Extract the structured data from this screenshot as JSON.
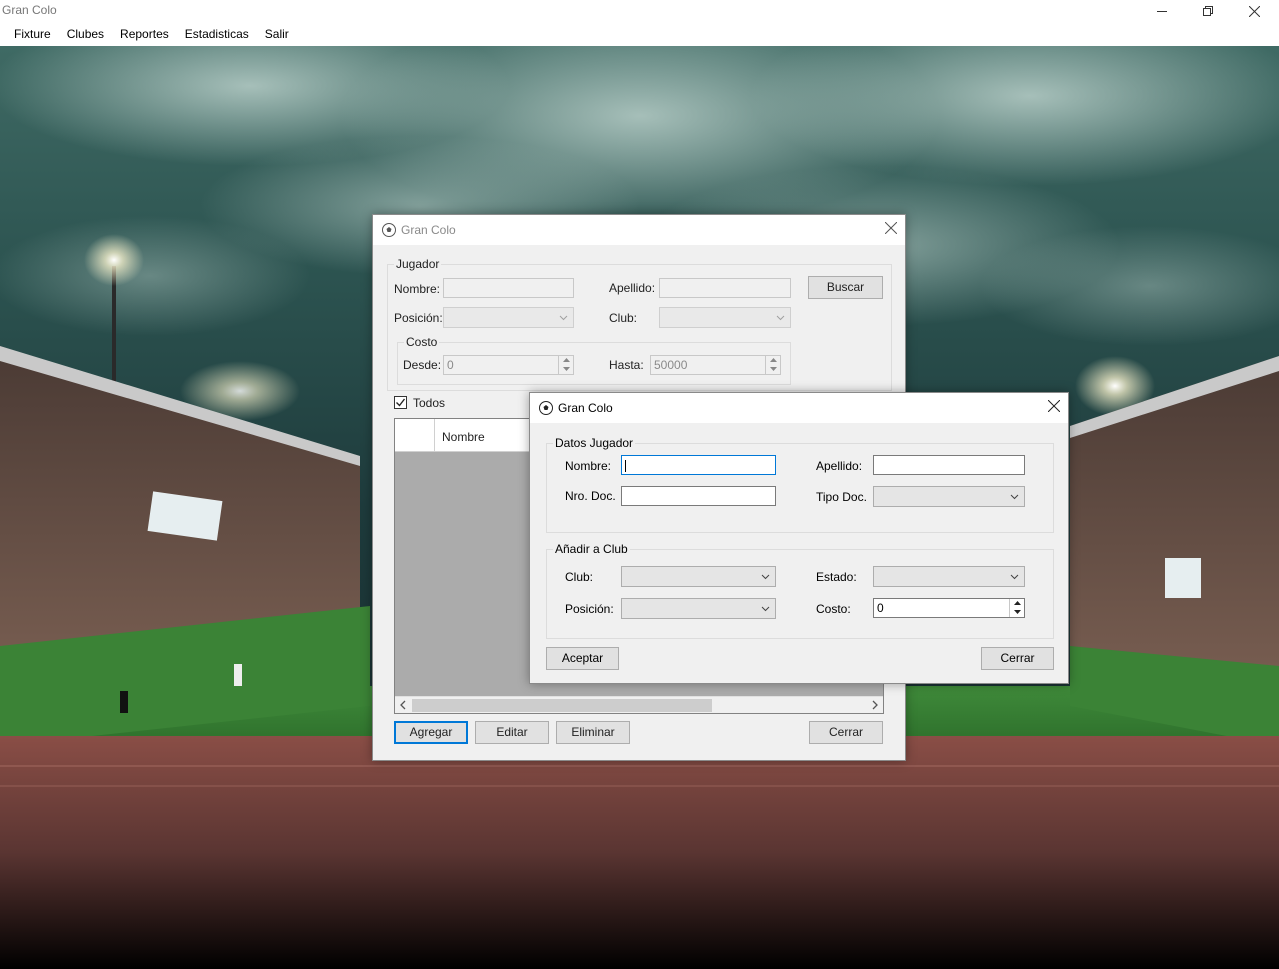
{
  "app": {
    "title": "Gran Colo"
  },
  "menu": [
    "Fixture",
    "Clubes",
    "Reportes",
    "Estadisticas",
    "Salir"
  ],
  "players_dialog": {
    "title": "Gran Colo",
    "group_label": "Jugador",
    "nombre_label": "Nombre:",
    "nombre_value": "",
    "apellido_label": "Apellido:",
    "apellido_value": "",
    "buscar_label": "Buscar",
    "posicion_label": "Posición:",
    "posicion_value": "",
    "club_label": "Club:",
    "club_value": "",
    "costo_group_label": "Costo",
    "desde_label": "Desde:",
    "desde_value": "0",
    "hasta_label": "Hasta:",
    "hasta_value": "50000",
    "todos_label": "Todos",
    "todos_checked": true,
    "grid_columns": [
      "Nombre"
    ],
    "agregar_label": "Agregar",
    "editar_label": "Editar",
    "eliminar_label": "Eliminar",
    "cerrar_label": "Cerrar"
  },
  "add_dialog": {
    "title": "Gran Colo",
    "datos_group_label": "Datos Jugador",
    "nombre_label": "Nombre:",
    "nombre_value": "",
    "apellido_label": "Apellido:",
    "apellido_value": "",
    "nro_doc_label": "Nro. Doc.",
    "nro_doc_value": "",
    "tipo_doc_label": "Tipo Doc.",
    "tipo_doc_value": "",
    "club_group_label": "Añadir a Club",
    "club_label": "Club:",
    "club_value": "",
    "estado_label": "Estado:",
    "estado_value": "",
    "posicion_label": "Posición:",
    "posicion_value": "",
    "costo_label": "Costo:",
    "costo_value": "0",
    "aceptar_label": "Aceptar",
    "cerrar_label": "Cerrar"
  }
}
